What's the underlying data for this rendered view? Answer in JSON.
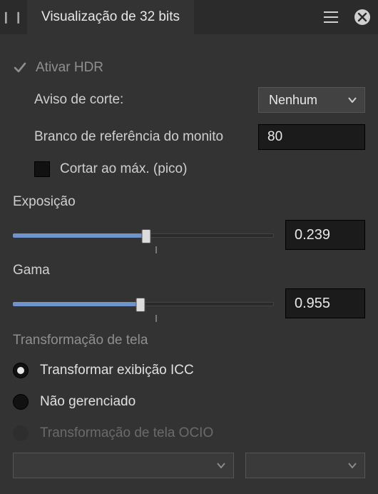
{
  "tab": {
    "title": "Visualização de 32 bits"
  },
  "hdr": {
    "enable_label": "Ativar HDR",
    "clip_warning_label": "Aviso de corte:",
    "clip_warning_value": "Nenhum",
    "ref_white_label": "Branco de referência do monito",
    "ref_white_value": "80",
    "clip_peak_label": "Cortar ao máx. (pico)"
  },
  "exposure": {
    "label": "Exposição",
    "value": "0.239",
    "percent": 51,
    "tick_percent": 55
  },
  "gamma": {
    "label": "Gama",
    "value": "0.955",
    "percent": 49,
    "tick_percent": 55
  },
  "screen_transform": {
    "heading": "Transformação de tela",
    "icc_label": "Transformar exibição ICC",
    "unmanaged_label": "Não gerenciado",
    "ocio_label": "Transformação de tela OCIO"
  }
}
